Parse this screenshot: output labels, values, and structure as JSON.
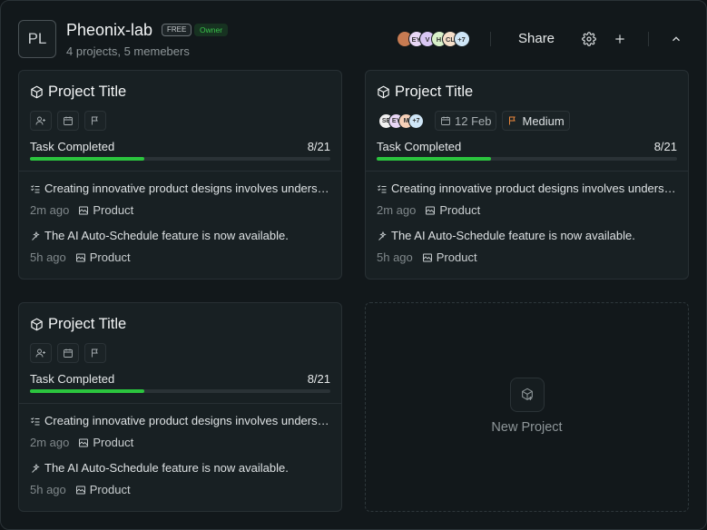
{
  "workspace": {
    "initials": "PL",
    "name": "Pheonix-lab",
    "plan_badge": "FREE",
    "role_badge": "Owner",
    "meta": "4 projects, 5 memebers"
  },
  "header": {
    "members": [
      {
        "label": "",
        "color": "#c77b52"
      },
      {
        "label": "EY",
        "color": "#e9d7f6"
      },
      {
        "label": "V",
        "color": "#d9c7f4"
      },
      {
        "label": "H",
        "color": "#d8f0c9"
      },
      {
        "label": "CL",
        "color": "#f5dec9"
      },
      {
        "label": "+7",
        "color": "#cfe6f7"
      }
    ],
    "share_label": "Share",
    "icons": [
      "settings-icon",
      "plus-icon",
      "chevron-up-icon"
    ]
  },
  "projects": [
    {
      "title": "Project Title",
      "members": [],
      "date": "",
      "priority": "",
      "progress_label": "Task Completed",
      "progress_text": "8/21",
      "progress_value": 0.381,
      "activities": [
        {
          "text": "Creating innovative product designs involves understanding user needs",
          "time": "2m ago",
          "tag": "Product",
          "icon": "checklist-icon"
        },
        {
          "text": "The AI Auto-Schedule feature is now available.",
          "time": "5h ago",
          "tag": "Product",
          "icon": "sparkle-icon"
        }
      ]
    },
    {
      "title": "Project Title",
      "members": [
        {
          "label": "SE",
          "color": "#f1f1f1"
        },
        {
          "label": "EY",
          "color": "#e9d7f6"
        },
        {
          "label": "M",
          "color": "#f6d0b8"
        },
        {
          "label": "+7",
          "color": "#cfe6f7"
        }
      ],
      "date": "12 Feb",
      "priority": "Medium",
      "priority_color": "#f08a3c",
      "progress_label": "Task Completed",
      "progress_text": "8/21",
      "progress_value": 0.381,
      "activities": [
        {
          "text": "Creating innovative product designs involves understanding user needs",
          "time": "2m ago",
          "tag": "Product",
          "icon": "checklist-icon"
        },
        {
          "text": "The AI Auto-Schedule feature is now available.",
          "time": "5h ago",
          "tag": "Product",
          "icon": "sparkle-icon"
        }
      ]
    },
    {
      "title": "Project Title",
      "members": [],
      "date": "",
      "priority": "",
      "progress_label": "Task Completed",
      "progress_text": "8/21",
      "progress_value": 0.381,
      "activities": [
        {
          "text": "Creating innovative product designs involves understanding user needs",
          "time": "2m ago",
          "tag": "Product",
          "icon": "checklist-icon"
        },
        {
          "text": "The AI Auto-Schedule feature is now available.",
          "time": "5h ago",
          "tag": "Product",
          "icon": "sparkle-icon"
        }
      ]
    }
  ],
  "new_project": {
    "label": "New Project"
  },
  "colors": {
    "accent_green": "#2bc43e",
    "background": "#12181b",
    "card": "#182023"
  }
}
